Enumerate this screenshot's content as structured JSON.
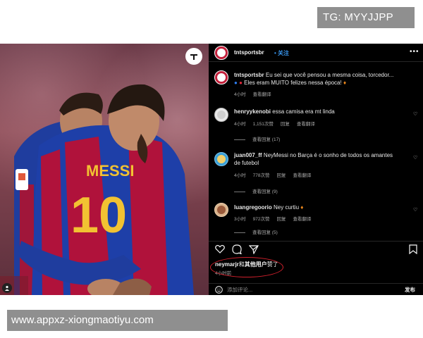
{
  "watermarks": {
    "top": "TG: MYYJJPP",
    "bottom": "www.appxz-xiongmaotiyu.com"
  },
  "post": {
    "username": "tntsportsbr",
    "follow_label": "• 关注",
    "time_ago": "4小时前"
  },
  "caption": {
    "username": "tntsportsbr",
    "line1": "Eu sei que você pensou a mesma coisa, torcedor...",
    "line2": "Eles eram MUITO felizes nessa época!",
    "time": "4小时",
    "translate": "查看翻译"
  },
  "comments": [
    {
      "username": "henryykenobi",
      "text": "essa camisa era mt linda",
      "time": "4小时",
      "likes": "1,151次赞",
      "reply": "回复",
      "translate": "查看翻译",
      "replies": "查看回复 (17)"
    },
    {
      "username": "juan007_ff",
      "text1": "NeyMessi no Barça é o sonho de todos os amantes",
      "text2": "de futebol",
      "time": "4小时",
      "likes": "778次赞",
      "reply": "回复",
      "translate": "查看翻译",
      "replies": "查看回复 (9)"
    },
    {
      "username": "luangregoorio",
      "text": "Ney curtiu",
      "time": "3小时",
      "likes": "972次赞",
      "reply": "回复",
      "translate": "查看翻译",
      "replies": "查看回复 (5)"
    }
  ],
  "likes": {
    "user": "neymarjr",
    "connector": "和",
    "others": "其他用户",
    "suffix": "赞了"
  },
  "comment_box": {
    "placeholder": "添加评论...",
    "post_label": "发布"
  },
  "colors": {
    "panel_bg": "#000000",
    "link_blue": "#3897f0",
    "highlight_red": "#d0202c",
    "watermark_gray": "#8f8f8f"
  }
}
